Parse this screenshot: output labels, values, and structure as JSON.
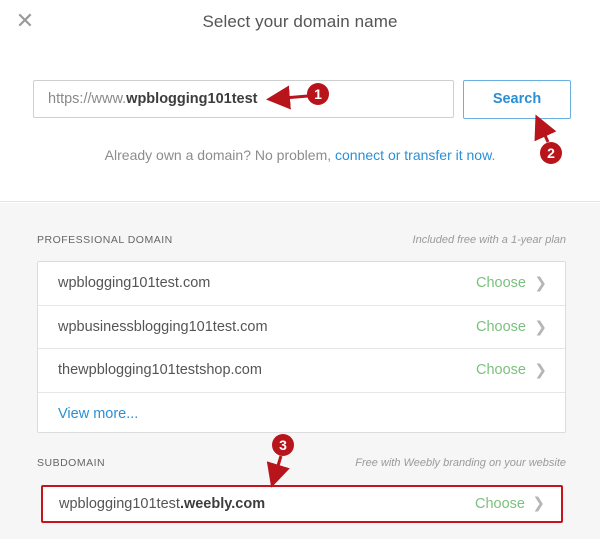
{
  "dialog": {
    "title": "Select your domain name",
    "close_label": "✕"
  },
  "search": {
    "prefix": "https://www.",
    "value": "wpblogging101test",
    "button_label": "Search"
  },
  "already_own": {
    "text": "Already own a domain? No problem, ",
    "link_text": "connect or transfer it now",
    "suffix": "."
  },
  "professional": {
    "label": "PROFESSIONAL DOMAIN",
    "note": "Included free with a 1-year plan",
    "items": [
      {
        "domain": "wpblogging101test.com",
        "action": "Choose"
      },
      {
        "domain": "wpbusinessblogging101test.com",
        "action": "Choose"
      },
      {
        "domain": "thewpblogging101testshop.com",
        "action": "Choose"
      }
    ],
    "view_more": "View more..."
  },
  "subdomain": {
    "label": "SUBDOMAIN",
    "note": "Free with Weebly branding on your website",
    "name": "wpblogging101test",
    "suffix": ".weebly.com",
    "action": "Choose"
  },
  "annotations": {
    "marker_1": "1",
    "marker_2": "2",
    "marker_3": "3",
    "color": "#b8141b"
  },
  "colors": {
    "accent": "#2b8fd4",
    "choose": "#7bc17e",
    "highlight": "#c5141b"
  },
  "icons": {
    "close": "close-icon",
    "chevron": "chevron-right-icon"
  }
}
